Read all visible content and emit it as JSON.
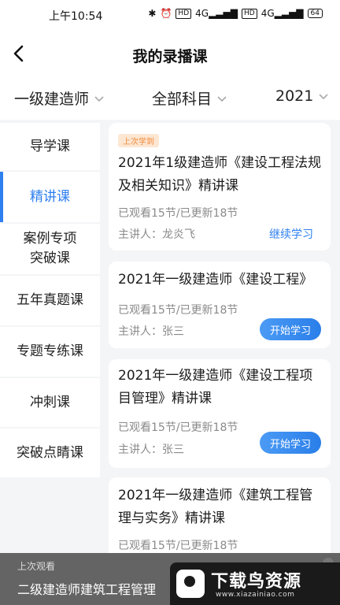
{
  "status_bar": {
    "time": "上午10:54",
    "signal_a": "4G",
    "signal_b": "4G",
    "battery": "64"
  },
  "header": {
    "title": "我的录播课"
  },
  "filters": {
    "exam": "一级建造师",
    "subject": "全部科目",
    "year": "2021"
  },
  "sidebar": {
    "items": [
      {
        "label": "导学课"
      },
      {
        "label": "精讲课"
      },
      {
        "label": "案例专项\n突破课"
      },
      {
        "label": "五年真题课"
      },
      {
        "label": "专题专练课"
      },
      {
        "label": "冲刺课"
      },
      {
        "label": "突破点睛课"
      }
    ],
    "active_index": 1
  },
  "courses": [
    {
      "tag": "上次学到",
      "title": "2021年1级建造师《建设工程法规及相关知识》精讲课",
      "progress": "已观看15节/已更新18节",
      "teacher": "主讲人：龙炎飞",
      "action": "继续学习"
    },
    {
      "title": "2021年一级建造师《建设工程》",
      "progress": "已观看15节/已更新18节",
      "teacher": "主讲人：张三",
      "action": "开始学习"
    },
    {
      "title": "2021年一级建造师《建设工程项目管理》精讲课",
      "progress": "已观看15节/已更新18节",
      "teacher": "主讲人：张三",
      "action": "开始学习"
    },
    {
      "title": "2021年一级建造师《建筑工程管理与实务》精讲课",
      "progress": "已观看15节/已更新18节"
    }
  ],
  "banner": {
    "label": "上次观看",
    "course": "二级建造师建筑工程管理"
  },
  "watermark": {
    "name": "下载鸟资源",
    "url": "www.xiazainiao.com"
  },
  "colors": {
    "accent": "#2e7ff0",
    "tag_bg": "#fde7d3",
    "tag_text": "#ef8a3b",
    "muted": "#8a8a8a"
  }
}
